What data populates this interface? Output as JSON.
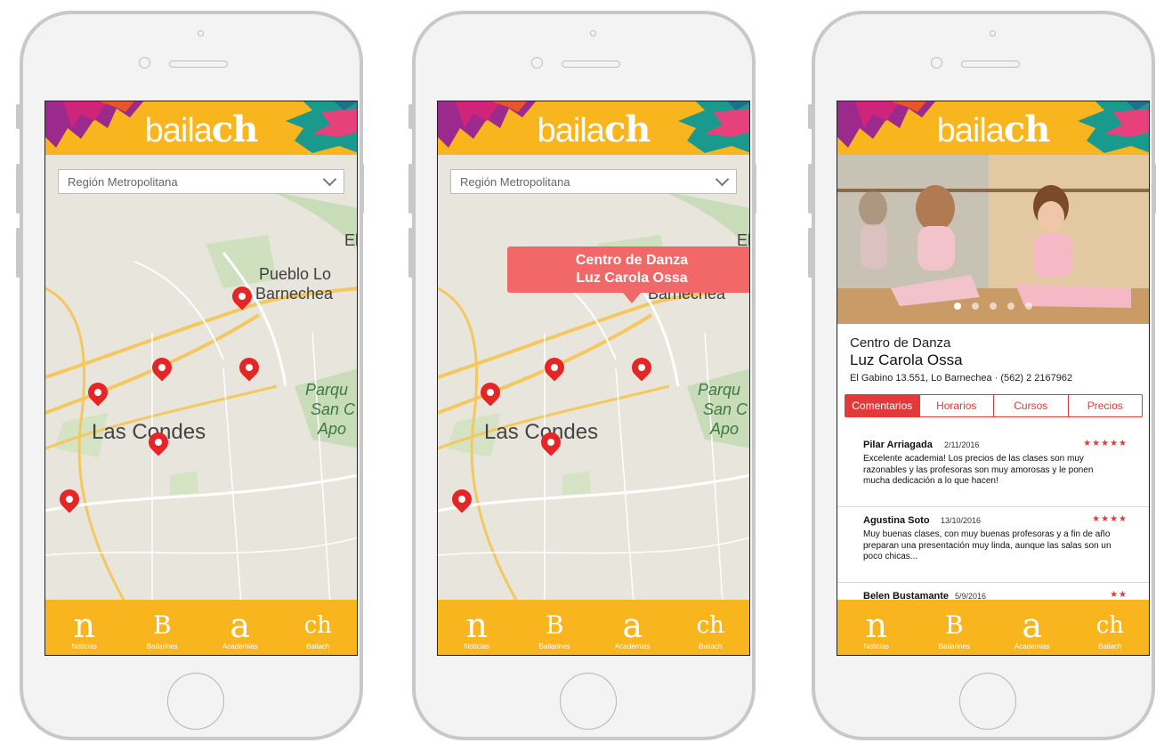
{
  "app": {
    "logo_light": "baila",
    "logo_bold": "ch"
  },
  "colors": {
    "accent_yellow": "#f8b51d",
    "accent_red": "#e23a3a",
    "tooltip": "#f26868"
  },
  "map_screen": {
    "region_select": "Región Metropolitana",
    "labels": {
      "el": "El",
      "pueblo": "Pueblo Lo",
      "barnechea": "Barnechea",
      "las_condes": "Las Condes",
      "parque": "Parqu",
      "san": "San C",
      "apo": "Apo"
    }
  },
  "tooltip": {
    "line1": "Centro de Danza",
    "line2": "Luz Carola Ossa"
  },
  "tabbar": [
    {
      "glyph": "n",
      "label": "Noticias"
    },
    {
      "glyph": "B",
      "label": "Bailarines"
    },
    {
      "glyph": "a",
      "label": "Academias"
    },
    {
      "glyph": "ch",
      "label": "Bailach"
    }
  ],
  "academy": {
    "name_line1": "Centro de Danza",
    "name_line2": "Luz Carola Ossa",
    "address": "El Gabino 13.551, Lo Barnechea  ·  (562) 2 2167962",
    "tabs": [
      "Comentarios",
      "Horarios",
      "Cursos",
      "Precios"
    ],
    "active_tab": "Comentarios",
    "carousel_page": 1,
    "carousel_total": 5,
    "reviews": [
      {
        "name": "Pilar Arriagada",
        "date": "2/11/2016",
        "stars": "★★★★★",
        "rating": 5,
        "text": "Excelente academia! Los precios de las clases son muy razonables y las profesoras son muy amorosas y le ponen mucha dedicación a lo que hacen!"
      },
      {
        "name": "Agustina Soto",
        "date": "13/10/2016",
        "stars": "★★★★",
        "rating": 4,
        "text": "Muy buenas clases, con muy buenas profesoras y a fin de año preparan una presentación muy linda, aunque las salas son un poco chicas..."
      },
      {
        "name": "Belen Bustamante",
        "date": "5/9/2016",
        "stars": "★★",
        "rating": 2,
        "text": ""
      }
    ]
  }
}
